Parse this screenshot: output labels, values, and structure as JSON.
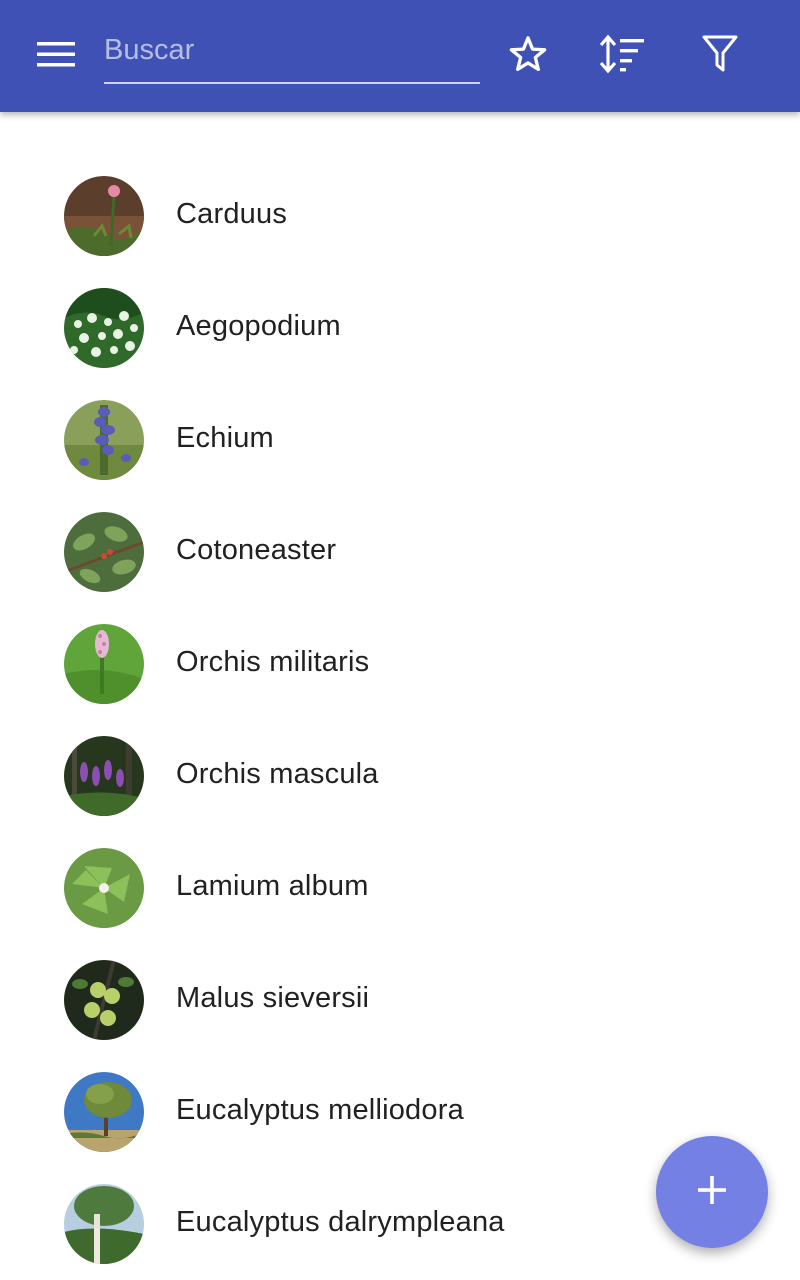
{
  "colors": {
    "app_bar": "#3f51b5",
    "fab": "#7480e3",
    "text_primary": "#212121",
    "icon": "#ffffff"
  },
  "toolbar": {
    "menu_icon": "hamburger-menu-icon",
    "search": {
      "placeholder": "Buscar",
      "value": ""
    },
    "actions": [
      {
        "icon": "star-outline-icon"
      },
      {
        "icon": "sort-icon"
      },
      {
        "icon": "filter-icon"
      }
    ]
  },
  "plants": [
    {
      "name": "Carduus",
      "thumb_icon": "plant-photo-icon"
    },
    {
      "name": "Aegopodium",
      "thumb_icon": "plant-photo-icon"
    },
    {
      "name": "Echium",
      "thumb_icon": "plant-photo-icon"
    },
    {
      "name": "Cotoneaster",
      "thumb_icon": "plant-photo-icon"
    },
    {
      "name": "Orchis militaris",
      "thumb_icon": "plant-photo-icon"
    },
    {
      "name": "Orchis mascula",
      "thumb_icon": "plant-photo-icon"
    },
    {
      "name": "Lamium album",
      "thumb_icon": "plant-photo-icon"
    },
    {
      "name": "Malus sieversii",
      "thumb_icon": "plant-photo-icon"
    },
    {
      "name": "Eucalyptus melliodora",
      "thumb_icon": "plant-photo-icon"
    },
    {
      "name": "Eucalyptus dalrympleana",
      "thumb_icon": "plant-photo-icon"
    }
  ],
  "fab": {
    "icon": "plus-icon"
  }
}
